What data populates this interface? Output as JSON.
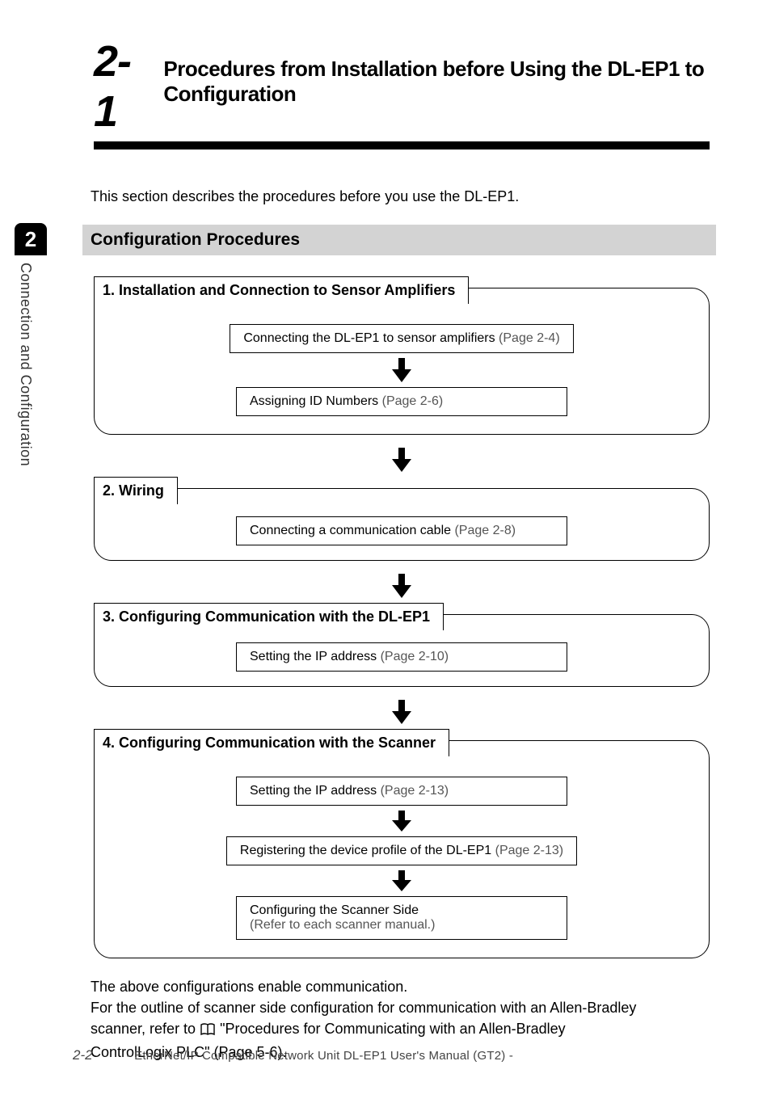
{
  "header": {
    "section_number": "2-1",
    "title": "Procedures from Installation before Using the DL-EP1 to Configuration"
  },
  "intro": "This section describes the procedures before you use the DL-EP1.",
  "subsection": "Configuration Procedures",
  "side": {
    "tab": "2",
    "label": "Connection and Configuration"
  },
  "groups": {
    "g1": {
      "label": "1. Installation and Connection to Sensor Amplifiers",
      "step1_strong": "Connecting the DL-EP1 to sensor amplifiers",
      "step1_ref": " (Page 2-4)",
      "step2_strong": "Assigning ID Numbers",
      "step2_ref": " (Page 2-6)"
    },
    "g2": {
      "label": "2. Wiring",
      "step1_strong": "Connecting a communication cable",
      "step1_ref": " (Page 2-8)"
    },
    "g3": {
      "label": "3. Configuring Communication with the DL-EP1",
      "step1_strong": "Setting the IP address",
      "step1_ref": " (Page 2-10)"
    },
    "g4": {
      "label": "4. Configuring Communication with the Scanner",
      "step1_strong": "Setting the IP address",
      "step1_ref": " (Page 2-13)",
      "step2_strong": "Registering the device profile of the DL-EP1",
      "step2_ref": " (Page 2-13)",
      "step3_line1": "Configuring the Scanner Side",
      "step3_line2": "(Refer to each scanner manual.)"
    }
  },
  "closing": {
    "line1": "The above configurations enable communication.",
    "line2a": "For the outline of scanner side configuration for communication with an Allen-Bradley",
    "line3a": "scanner, refer to ",
    "line3b": " \"Procedures for Communicating with an Allen-Bradley",
    "line4": "ControlLogix PLC\" (Page 5-6)."
  },
  "footer": {
    "page": "2-2",
    "title": "- EtherNet/IP Compatible Network Unit DL-EP1 User's Manual (GT2) -"
  }
}
